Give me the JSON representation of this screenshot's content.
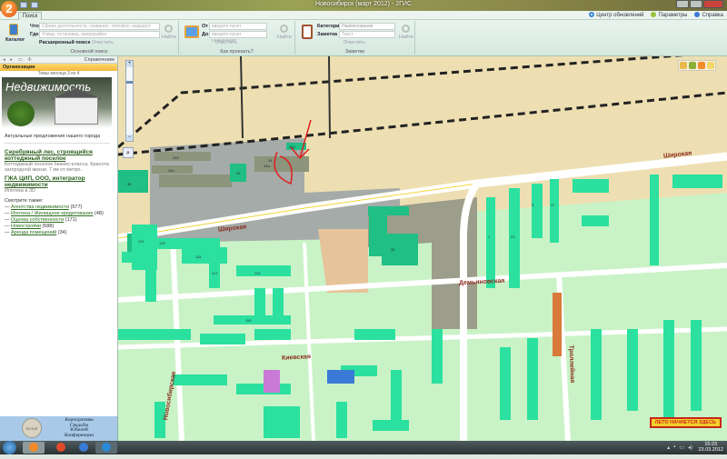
{
  "window": {
    "title": "Новосибирск (март 2012) - 2ГИС",
    "logo": "2"
  },
  "tabs": [
    {
      "label": "Поиск",
      "active": true
    }
  ],
  "toplinks": [
    {
      "label": "Центр обновлений",
      "icon": "refresh-icon"
    },
    {
      "label": "Параметры",
      "icon": "settings-icon"
    },
    {
      "label": "Справка",
      "icon": "help-icon"
    }
  ],
  "ribbon": {
    "main_search": {
      "catalog": "Каталог",
      "what_label": "Что",
      "what_placeholder": "Сфера деятельности, название, телефон, маршрут",
      "where_label": "Где",
      "where_placeholder": "Улица, остановка, микрорайон",
      "advanced": "Расширенный поиск",
      "clear": "Очистить",
      "find": "Найти",
      "group": "Основной поиск"
    },
    "route": {
      "from_label": "От",
      "from_placeholder": "введите пункт отправления",
      "to_label": "До",
      "to_placeholder": "введите пункт назначения",
      "clear": "Очистить",
      "find": "Найти",
      "group": "Как проехать?"
    },
    "notes": {
      "category_label": "Категория",
      "category_value": "Наименование",
      "note_label": "Заметка",
      "note_placeholder": "Текст",
      "clear": "Очистить",
      "find": "Найти",
      "group": "Заметки"
    }
  },
  "sidebar": {
    "directories": "Справочники",
    "orgs": "Организации",
    "themes": "Темы месяца 3 из 4",
    "banner_title": "Недвижимость",
    "subtitle": "Актуальные предложения нашего города",
    "orgs_list": [
      {
        "name": "Серебряный лес, строящийся коттеджный поселок",
        "desc": "Коттеджный поселок бизнес-класса. Красота загородной жизни. 7 км от метро."
      },
      {
        "name": "ГЖА ЦИП, ООО, интегратор недвижимости",
        "desc": "Ипотека в 3D"
      }
    ],
    "see_also_title": "Смотрите также:",
    "see_also": [
      {
        "label": "Агентства недвижимости",
        "count": "(577)"
      },
      {
        "label": "Ипотека / Жилищное кредитование",
        "count": "(48)"
      },
      {
        "label": "Оценка собственности",
        "count": "(171)"
      },
      {
        "label": "Новостройки",
        "count": "(588)"
      },
      {
        "label": "Аренда помещений",
        "count": "(34)"
      }
    ]
  },
  "ad": {
    "seal": "БЕЛЫЙ ЗАЛ",
    "lines": [
      "Корпоративы",
      "Свадьбы",
      "Юбилей",
      "Конференции"
    ]
  },
  "map": {
    "streets": [
      "Широкая",
      "Широкая",
      "Демьяновская",
      "Киевская",
      "Новосибирская",
      "Троллейная"
    ],
    "buildings": [
      "34",
      "34а",
      "34б",
      "34в",
      "36",
      "26а",
      "26",
      "38",
      "115",
      "113",
      "121",
      "125",
      "119",
      "117",
      "23",
      "1",
      "17",
      "5"
    ],
    "promo": "ЛЕТО НАЧНЕТСЯ ЗДЕСЬ"
  },
  "taskbar": {
    "time": "15:23",
    "date": "23.03.2012"
  },
  "colors": {
    "accent": "#f4b93a",
    "residential": "#2fd49a",
    "industrial": "#9aa3a0"
  }
}
